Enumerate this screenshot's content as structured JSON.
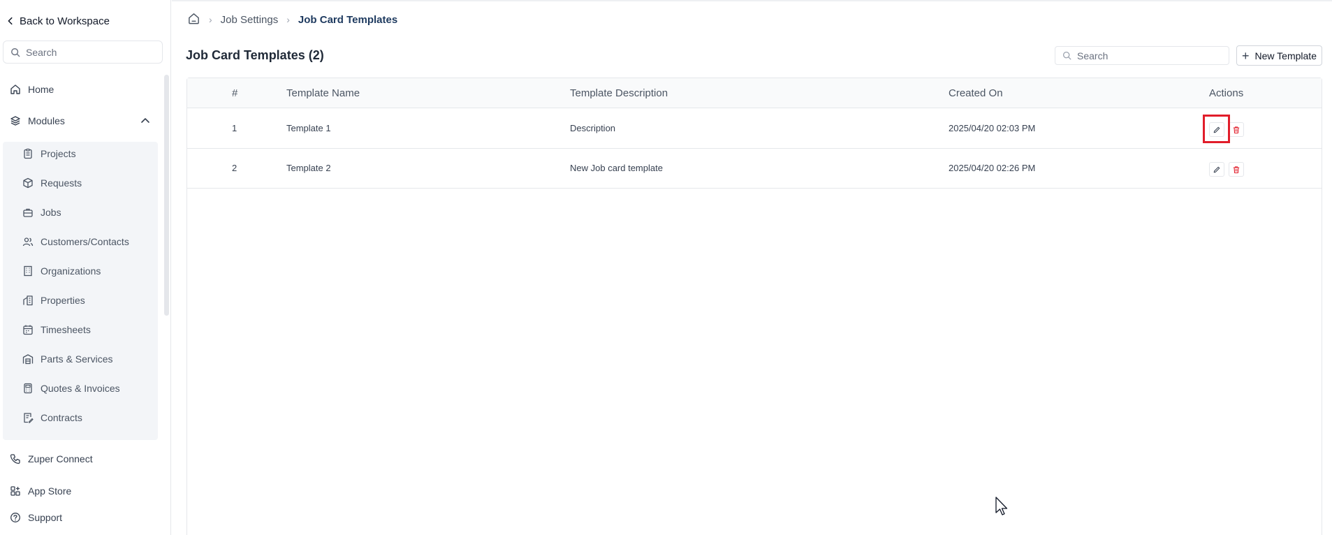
{
  "sidebar": {
    "back_label": "Back to Workspace",
    "search_placeholder": "Search",
    "home_label": "Home",
    "modules_label": "Modules",
    "modules_items": [
      {
        "label": "Projects",
        "icon": "clipboard-icon"
      },
      {
        "label": "Requests",
        "icon": "box-icon"
      },
      {
        "label": "Jobs",
        "icon": "briefcase-icon"
      },
      {
        "label": "Customers/Contacts",
        "icon": "users-icon"
      },
      {
        "label": "Organizations",
        "icon": "building-icon"
      },
      {
        "label": "Properties",
        "icon": "property-icon"
      },
      {
        "label": "Timesheets",
        "icon": "calendar-icon"
      },
      {
        "label": "Parts & Services",
        "icon": "warehouse-icon"
      },
      {
        "label": "Quotes & Invoices",
        "icon": "calculator-icon"
      },
      {
        "label": "Contracts",
        "icon": "contract-icon"
      }
    ],
    "zuper_connect_label": "Zuper Connect",
    "app_store_label": "App Store",
    "support_label": "Support"
  },
  "breadcrumb": {
    "items": [
      "Job Settings",
      "Job Card Templates"
    ]
  },
  "page": {
    "title": "Job Card Templates (2)",
    "search_placeholder": "Search",
    "new_template_label": "New Template"
  },
  "table": {
    "columns": [
      "#",
      "Template Name",
      "Template Description",
      "Created On",
      "Actions"
    ],
    "rows": [
      {
        "num": "1",
        "name": "Template 1",
        "description": "Description",
        "created": "2025/04/20 02:03 PM"
      },
      {
        "num": "2",
        "name": "Template 2",
        "description": "New Job card template",
        "created": "2025/04/20 02:26 PM"
      }
    ]
  },
  "colors": {
    "accent_text": "#1e3a5f",
    "delete_red": "#e11d2a",
    "highlight_red": "#e11d2a"
  }
}
